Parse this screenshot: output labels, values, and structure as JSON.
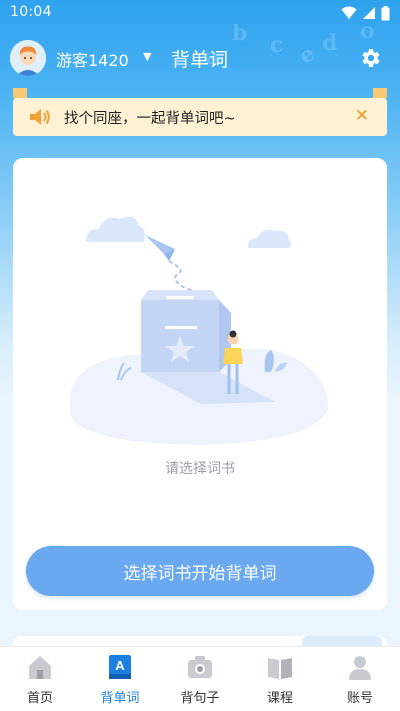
{
  "status_bar": {
    "time": "10:04"
  },
  "header": {
    "username": "游客1420",
    "title": "背单词"
  },
  "notice": {
    "text": "找个同座，一起背单词吧~",
    "close_label": "×"
  },
  "card": {
    "empty_text": "请选择词书",
    "start_button_label": "选择词书开始背单词"
  },
  "nav": {
    "items": [
      {
        "label": "首页",
        "icon": "home-icon",
        "active": false
      },
      {
        "label": "背单词",
        "icon": "word-book-icon",
        "active": true
      },
      {
        "label": "背句子",
        "icon": "camera-icon",
        "active": false
      },
      {
        "label": "课程",
        "icon": "book-icon",
        "active": false
      },
      {
        "label": "账号",
        "icon": "user-icon",
        "active": false
      }
    ]
  },
  "colors": {
    "primary": "#1d7fe0",
    "button": "#6aa8ef",
    "notice_bg": "#fff1d3",
    "notice_accent": "#f3a23a"
  }
}
